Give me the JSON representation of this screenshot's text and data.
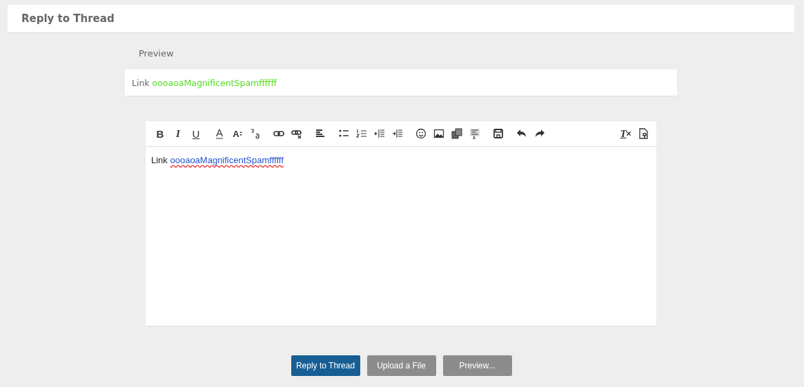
{
  "header": {
    "title": "Reply to Thread"
  },
  "preview": {
    "heading": "Preview",
    "prefix": "Link",
    "link": "oooaoaMagnificentSpamffffff"
  },
  "toolbar": {
    "groups": [
      [
        {
          "kind": "bold",
          "glyph": "B"
        },
        {
          "kind": "italic",
          "glyph": "I"
        },
        {
          "kind": "underline",
          "glyph": "U"
        }
      ],
      [
        {
          "kind": "font-color",
          "glyph": "A"
        },
        {
          "kind": "font-size",
          "glyph": "A"
        },
        {
          "kind": "subscript"
        }
      ],
      [
        {
          "kind": "link"
        },
        {
          "kind": "unlink"
        }
      ],
      [
        {
          "kind": "align"
        }
      ],
      [
        {
          "kind": "bullets"
        },
        {
          "kind": "numbers"
        },
        {
          "kind": "outdent"
        },
        {
          "kind": "indent"
        }
      ],
      [
        {
          "kind": "smiley"
        },
        {
          "kind": "image"
        },
        {
          "kind": "media"
        },
        {
          "kind": "quote"
        }
      ],
      [
        {
          "kind": "save"
        }
      ],
      [
        {
          "kind": "undo"
        },
        {
          "kind": "redo"
        }
      ]
    ],
    "right": [
      {
        "kind": "clear-format",
        "glyph": "T"
      },
      {
        "kind": "toggle-source"
      }
    ]
  },
  "editor": {
    "prefix": "Link",
    "link": "oooaoaMagnificentSpamffffff"
  },
  "buttons": [
    {
      "label": "Reply to Thread",
      "kind": "primary"
    },
    {
      "label": "Upload a File",
      "kind": "secondary"
    },
    {
      "label": "Preview...",
      "kind": "secondary"
    }
  ]
}
